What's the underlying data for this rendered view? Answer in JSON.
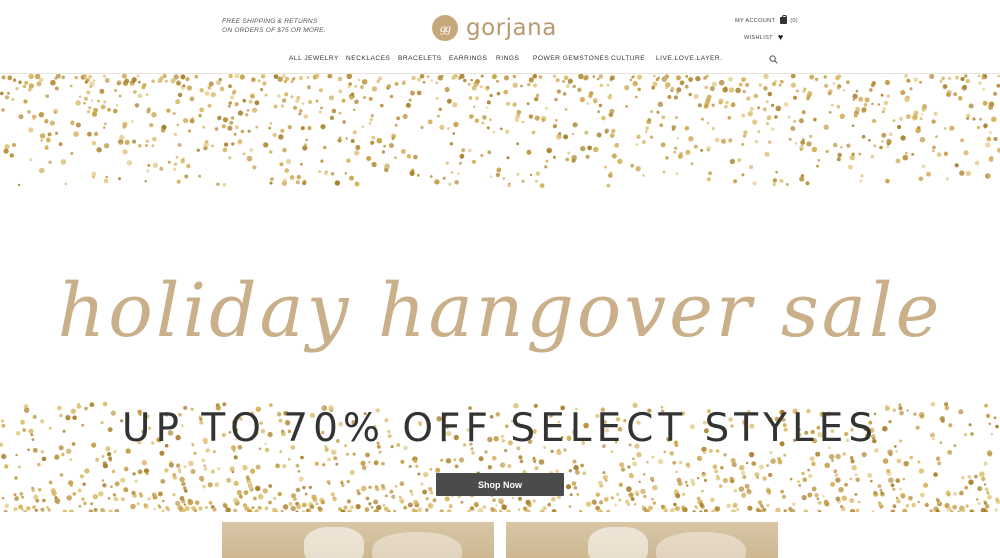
{
  "header": {
    "promo_line1": "FREE SHIPPING & RETURNS",
    "promo_line2": "ON ORDERS OF $75 OR MORE.",
    "logo_monogram": "gg",
    "logo_text": "gorjana",
    "account_label": "MY ACCOUNT",
    "bag_count": "(0)",
    "wishlist_label": "WISHLIST"
  },
  "nav": {
    "items": [
      {
        "label": "ALL JEWELRY"
      },
      {
        "label": "NECKLACES"
      },
      {
        "label": "BRACELETS"
      },
      {
        "label": "EARRINGS"
      },
      {
        "label": "RINGS"
      },
      {
        "label": "POWER GEMSTONES"
      },
      {
        "label": "CULTURE"
      },
      {
        "label": "LIVE.LOVE.LAYER."
      }
    ],
    "search_icon": "search-icon"
  },
  "hero": {
    "script_title": "holiday hangover sale",
    "headline": "UP TO 70% OFF SELECT STYLES",
    "cta_label": "Shop Now"
  },
  "colors": {
    "gold": "#c6a779",
    "script": "#c9b08a",
    "button": "#4b4b4b",
    "text": "#333333"
  }
}
